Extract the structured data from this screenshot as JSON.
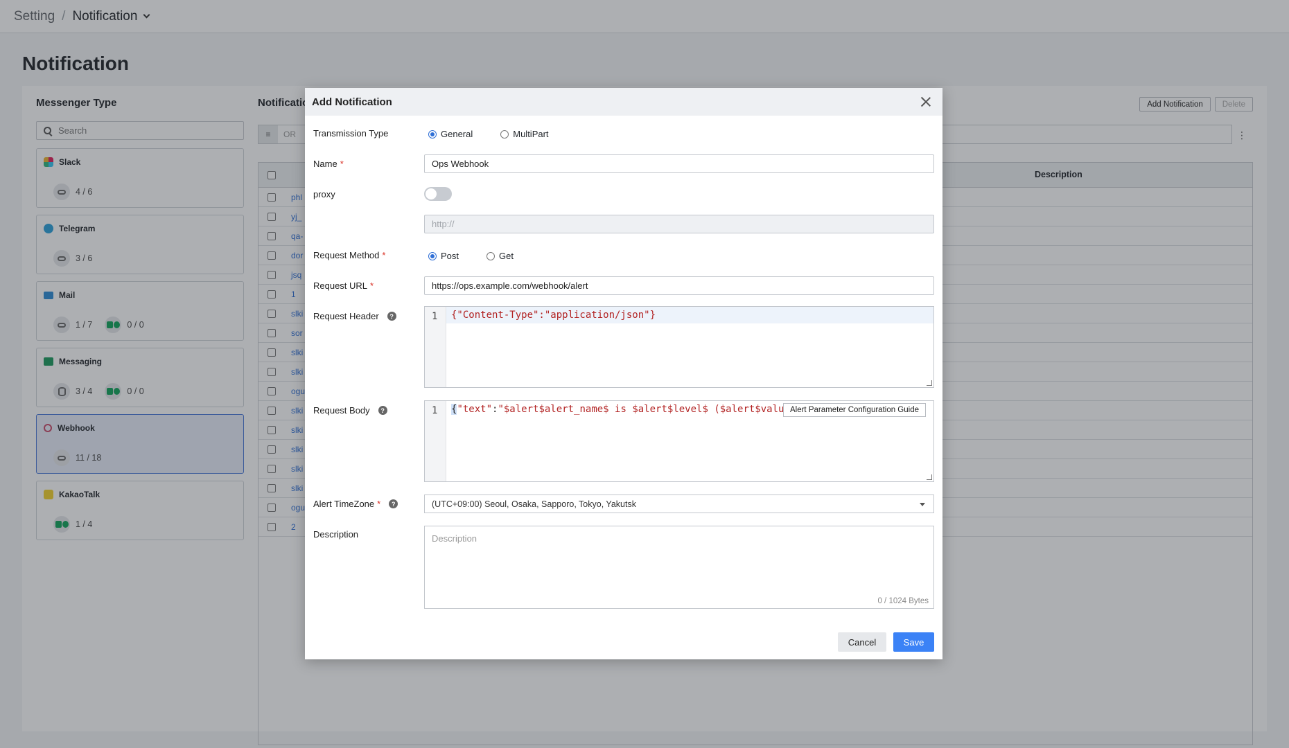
{
  "breadcrumb": {
    "root": "Setting",
    "separator": "/",
    "current": "Notification"
  },
  "page": {
    "title": "Notification"
  },
  "messenger": {
    "title": "Messenger Type",
    "search_placeholder": "Search",
    "cards": [
      {
        "name": "Slack",
        "logo": "slack-logo",
        "stats": [
          {
            "icon": "link-icon",
            "value": "4 / 6"
          }
        ]
      },
      {
        "name": "Telegram",
        "logo": "telegram-logo",
        "stats": [
          {
            "icon": "link-icon",
            "value": "3 / 6"
          }
        ]
      },
      {
        "name": "Mail",
        "logo": "mail-logo",
        "stats": [
          {
            "icon": "link-icon",
            "value": "1 / 7"
          },
          {
            "icon": "green-plugin-icon",
            "value": "0 / 0"
          }
        ]
      },
      {
        "name": "Messaging",
        "logo": "messaging-logo",
        "stats": [
          {
            "icon": "database-icon",
            "value": "3 / 4"
          },
          {
            "icon": "green-plugin-icon",
            "value": "0 / 0"
          }
        ]
      },
      {
        "name": "Webhook",
        "logo": "webhook-logo",
        "active": true,
        "stats": [
          {
            "icon": "link-icon",
            "value": "11 / 18"
          }
        ]
      },
      {
        "name": "KakaoTalk",
        "logo": "kakaotalk-logo",
        "stats": [
          {
            "icon": "green-plugin-icon",
            "value": "1 / 4"
          }
        ]
      }
    ]
  },
  "notifications": {
    "title": "Notificatio",
    "add_button": "Add Notification",
    "delete_button": "Delete",
    "filter_or": "OR",
    "description_header": "Description",
    "rows": [
      "phl",
      "yj_",
      "qa-",
      "dor",
      "jsq",
      "1",
      "slki",
      "sor",
      "slki",
      "slki",
      "ogu",
      "slki",
      "slki",
      "slki",
      "slki",
      "slki",
      "ogu",
      "2"
    ]
  },
  "modal": {
    "title": "Add Notification",
    "transmission_type": {
      "label": "Transmission Type",
      "options": [
        "General",
        "MultiPart"
      ],
      "selected": "General"
    },
    "name": {
      "label": "Name",
      "value": "Ops Webhook"
    },
    "proxy": {
      "label": "proxy",
      "enabled": false,
      "placeholder": "http://"
    },
    "request_method": {
      "label": "Request Method",
      "options": [
        "Post",
        "Get"
      ],
      "selected": "Post"
    },
    "request_url": {
      "label": "Request URL",
      "value": "https://ops.example.com/webhook/alert"
    },
    "request_header": {
      "label": "Request Header",
      "line_number": "1",
      "code": "{\"Content-Type\":\"application/json\"}"
    },
    "request_body": {
      "label": "Request Body",
      "line_number": "1",
      "code_open": "{",
      "code_key": "\"text\"",
      "code_colon": ":",
      "code_value": "\"$alert$alert_name$ is $alert$level$ ($alert$value",
      "guide_button": "Alert Parameter Configuration Guide"
    },
    "alert_timezone": {
      "label": "Alert TimeZone",
      "value": "(UTC+09:00) Seoul, Osaka, Sapporo, Tokyo, Yakutsk"
    },
    "description": {
      "label": "Description",
      "placeholder": "Description",
      "counter": "0 / 1024 Bytes"
    },
    "cancel_button": "Cancel",
    "save_button": "Save",
    "required_mark": "*",
    "help_mark": "?"
  }
}
